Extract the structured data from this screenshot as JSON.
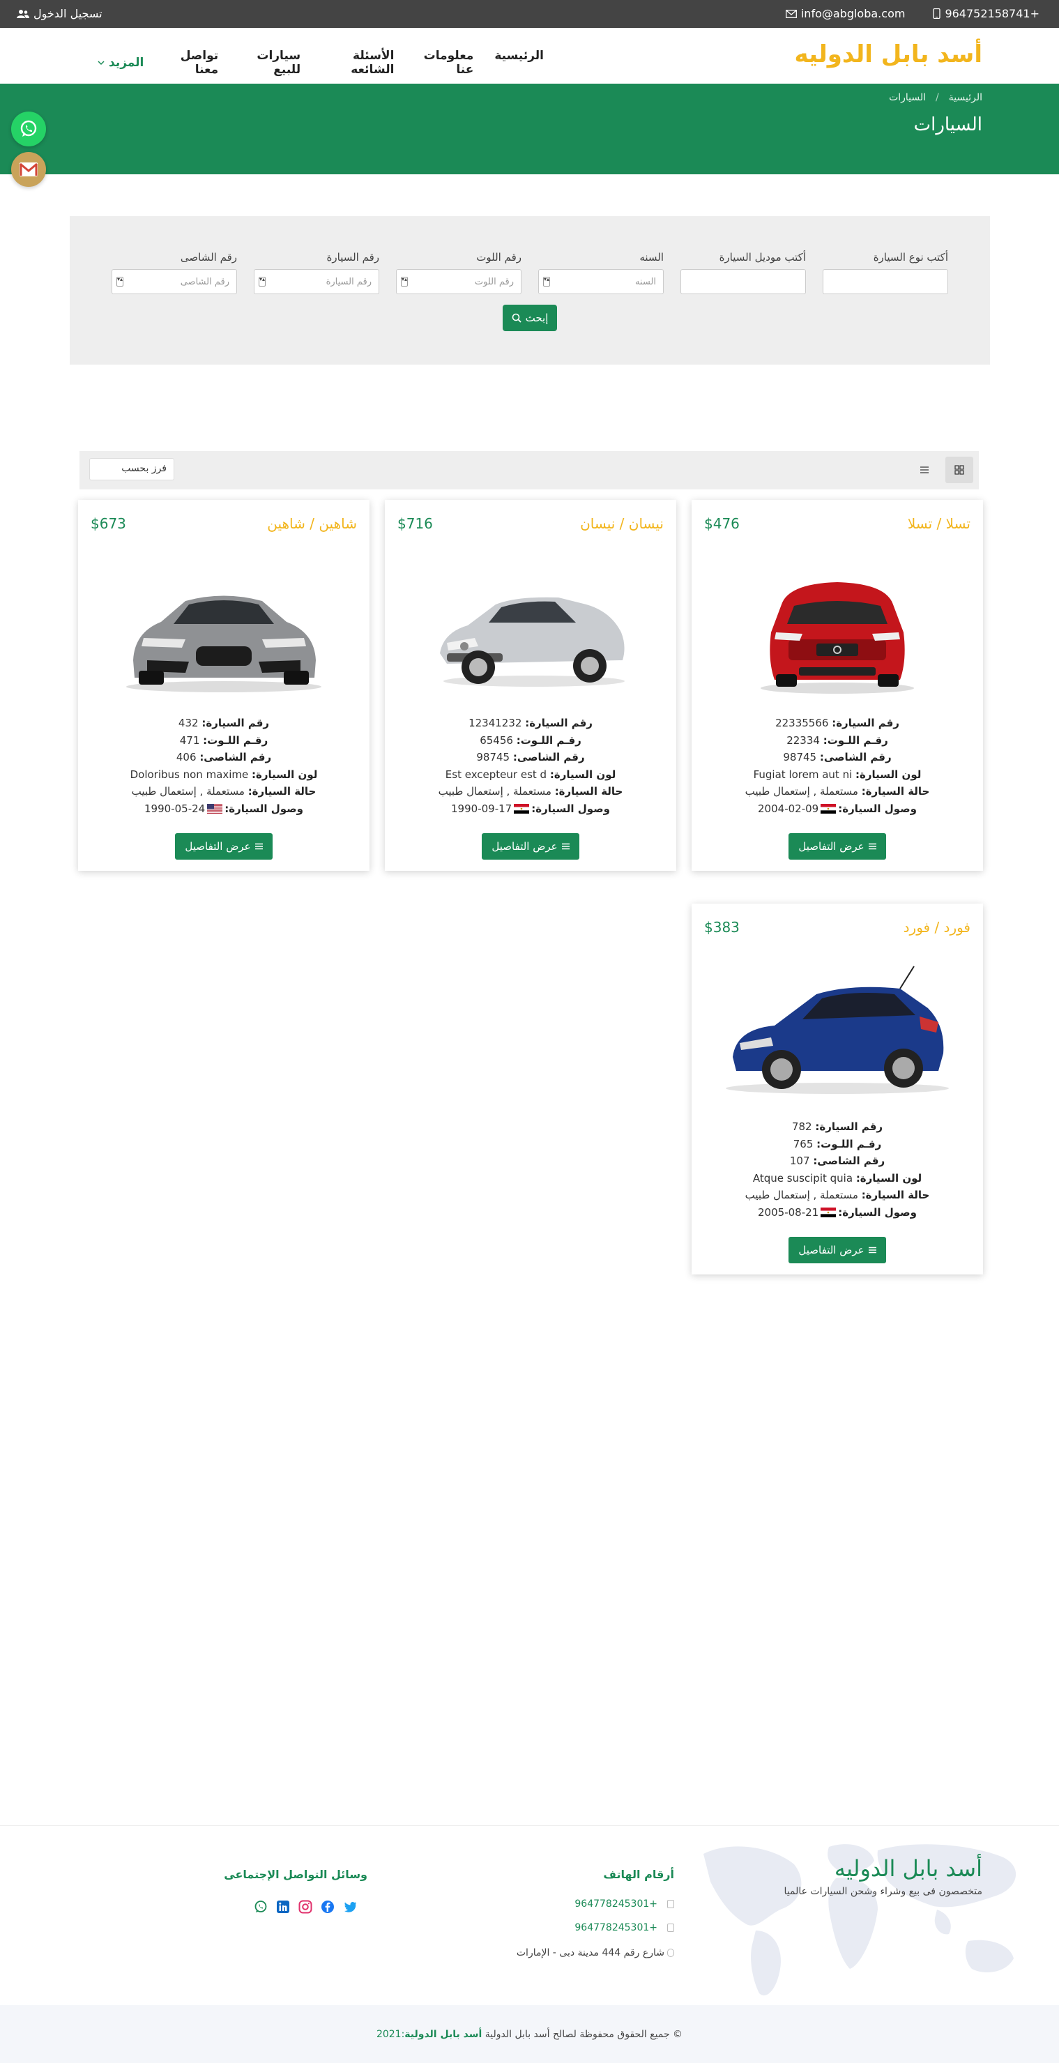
{
  "topbar": {
    "phone": "964752158741+",
    "email": "info@abgloba.com",
    "login": "تسجيل الدخول"
  },
  "navbar": {
    "brand": "أسد بابل الدوليه",
    "items": [
      "الرئيسية",
      "معلومات عنا",
      "الأسئلة الشائعه",
      "سيارات للبيع",
      "تواصل معنا"
    ],
    "more": "المزيد"
  },
  "hero": {
    "crumbs": [
      "الرئيسية",
      "السيارات"
    ],
    "title": "السيارات"
  },
  "search": {
    "fields": [
      {
        "label": "أكتب نوع السيارة",
        "placeholder": ""
      },
      {
        "label": "أكتب موديل السيارة",
        "placeholder": ""
      },
      {
        "label": "السنه",
        "placeholder": "السنه"
      },
      {
        "label": "رقم اللوت",
        "placeholder": "رقم اللوت"
      },
      {
        "label": "رقم السيارة",
        "placeholder": "رقم السيارة"
      },
      {
        "label": "رقم الشاصى",
        "placeholder": "رقم الشاصى"
      }
    ],
    "button": "إبحث"
  },
  "toolbar": {
    "sort_label": "فرز بحسب"
  },
  "labels": {
    "car_no": "رقم السيارة:",
    "lot_no": "رقـم اللـوت:",
    "chassis": "رقم الشاصى:",
    "color": "لون السيارة:",
    "condition": "حالة السيارة:",
    "arrival": "وصول السيارة:",
    "details": "عرض التفاصيل"
  },
  "colors": {
    "primary": "#1b8a56",
    "accent": "#f2b51d",
    "topbar": "#444444"
  },
  "cars": [
    {
      "price": "$476",
      "name": "تسلا / تسلا",
      "car_no": "22335566",
      "lot_no": "22334",
      "chassis": "98745",
      "color": "Fugiat lorem aut ni",
      "condition": "مستعملة , إستعمال طبيب",
      "flag": "egypt",
      "arrival": "09-02-2004",
      "image": "red-volvo"
    },
    {
      "price": "$716",
      "name": "نيسان / نيسان",
      "car_no": "12341232",
      "lot_no": "65456",
      "chassis": "98745",
      "color": "Est excepteur est d",
      "condition": "مستعملة , إستعمال طبيب",
      "flag": "egypt",
      "arrival": "17-09-1990",
      "image": "silver-mercedes"
    },
    {
      "price": "$673",
      "name": "شاهين / شاهين",
      "car_no": "432",
      "lot_no": "471",
      "chassis": "406",
      "color": "Doloribus non maxime",
      "condition": "مستعملة , إستعمال طبيب",
      "flag": "usa",
      "arrival": "24-05-1990",
      "image": "grey-kia"
    },
    {
      "price": "$383",
      "name": "فورد / فورد",
      "car_no": "782",
      "lot_no": "765",
      "chassis": "107",
      "color": "Atque suscipit quia",
      "condition": "مستعملة , إستعمال طبيب",
      "flag": "egypt",
      "arrival": "21-08-2005",
      "image": "blue-ford"
    }
  ],
  "footer": {
    "brand": "أسد بابل الدوليه",
    "tagline": "متخصصون فى بيع وشراء وشحن السيارات عالميا",
    "phones_title": "أرقام الهاتف",
    "phones": [
      "964778245301+",
      "964778245301+"
    ],
    "address": "شارع رقم 444 مدينة دبى - الإمارات",
    "social_title": "وسائل التواصل الإجتماعى",
    "copyright_text": "© جميع الحقوق محفوظة لصالح أسد بابل الدولية",
    "copyright_brand": "أسد بابل الدولية",
    "copyright_year": ":2021"
  }
}
